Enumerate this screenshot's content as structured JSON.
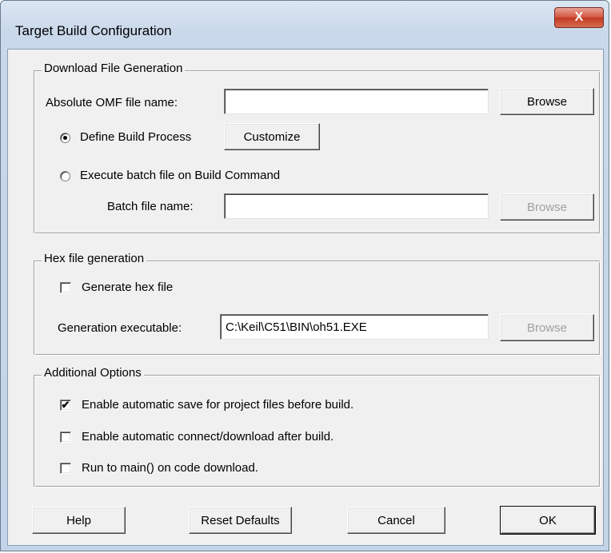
{
  "window": {
    "title": "Target Build Configuration",
    "close_glyph": "X"
  },
  "download_group": {
    "legend": "Download File Generation",
    "omf_label": "Absolute OMF file name:",
    "omf_value": "",
    "browse_label": "Browse",
    "define_build_label": "Define Build Process",
    "customize_label": "Customize",
    "execute_batch_label": "Execute batch file on Build Command",
    "batch_label": "Batch file name:",
    "batch_value": "",
    "batch_browse_label": "Browse",
    "selected_option": "Define Build Process"
  },
  "hex_group": {
    "legend": "Hex file generation",
    "generate_hex_label": "Generate hex file",
    "generate_hex_checked": false,
    "exec_label": "Generation executable:",
    "exec_value": "C:\\Keil\\C51\\BIN\\oh51.EXE",
    "browse_label": "Browse"
  },
  "additional_group": {
    "legend": "Additional Options",
    "options": [
      {
        "label": "Enable automatic save for project files before build.",
        "checked": true
      },
      {
        "label": "Enable automatic connect/download after build.",
        "checked": false
      },
      {
        "label": "Run to main() on code download.",
        "checked": false
      }
    ]
  },
  "footer": {
    "help_label": "Help",
    "reset_label": "Reset Defaults",
    "cancel_label": "Cancel",
    "ok_label": "OK"
  }
}
